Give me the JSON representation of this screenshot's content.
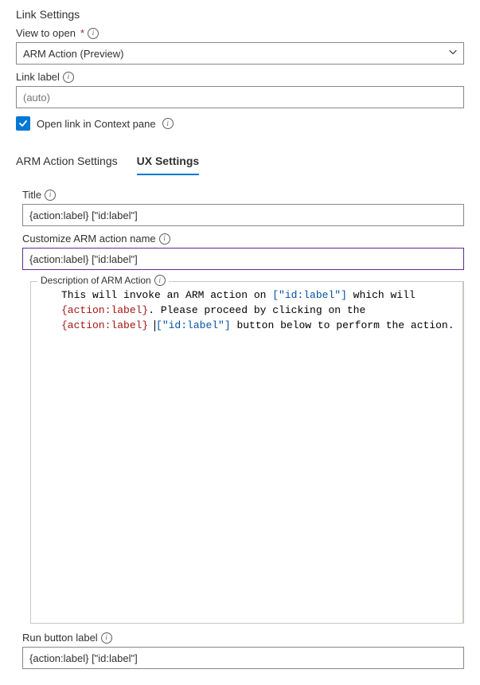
{
  "header": {
    "title": "Link Settings"
  },
  "viewToOpen": {
    "label": "View to open",
    "value": "ARM Action (Preview)"
  },
  "linkLabel": {
    "label": "Link label",
    "placeholder": "(auto)"
  },
  "openInContext": {
    "label": "Open link in Context pane",
    "checked": true
  },
  "tabs": {
    "arm": "ARM Action Settings",
    "ux": "UX Settings"
  },
  "titleField": {
    "label": "Title",
    "value": "{action:label} [\"id:label\"]"
  },
  "customizeArm": {
    "label": "Customize ARM action name",
    "value": "{action:label} [\"id:label\"]"
  },
  "description": {
    "label": "Description of ARM Action",
    "seg1": "This will invoke an ARM action on ",
    "seg2": "[\"id:label\"]",
    "seg3": " which will ",
    "seg4": "{action:label}",
    "seg5": ". Please proceed by clicking on the ",
    "seg6": "{action:label}",
    "seg7": " ",
    "seg8": "[\"id:label\"]",
    "seg9": " button below to perform the action."
  },
  "runButton": {
    "label": "Run button label",
    "value": "{action:label} [\"id:label\"]"
  }
}
